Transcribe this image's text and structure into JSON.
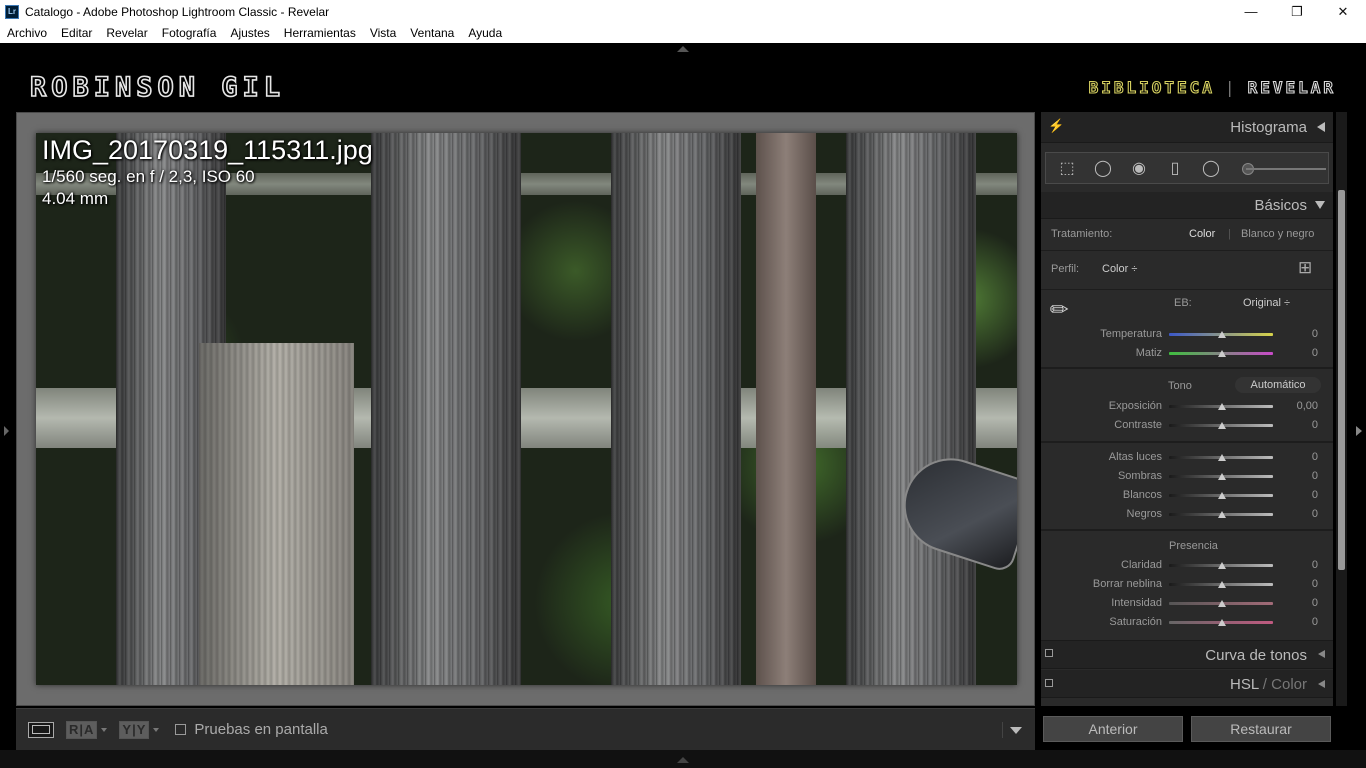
{
  "window": {
    "title": "Catalogo - Adobe Photoshop Lightroom Classic - Revelar",
    "app_icon": "Lr",
    "minimize": "—",
    "maximize": "❐",
    "close": "✕"
  },
  "menu": [
    "Archivo",
    "Editar",
    "Revelar",
    "Fotografía",
    "Ajustes",
    "Herramientas",
    "Vista",
    "Ventana",
    "Ayuda"
  ],
  "identity_plate": "ROBINSON GIL",
  "modules": {
    "active": "BIBLIOTECA",
    "separator": "|",
    "other": "REVELAR"
  },
  "photo_info": {
    "filename": "IMG_20170319_115311.jpg",
    "exposure": "1/560 seg. en f / 2,3, ISO 60",
    "focal": "4.04 mm"
  },
  "toolbar": {
    "before_after_1": "R|A",
    "before_after_2": "Y|Y",
    "soft_proof_label": "Pruebas en pantalla",
    "soft_proof_checked": false
  },
  "panels": {
    "histogram": {
      "title": "Histograma",
      "flash": "⚡"
    },
    "basics": {
      "title": "Básicos",
      "treatment": {
        "label": "Tratamiento:",
        "active": "Color",
        "separator": "|",
        "other": "Blanco y negro"
      },
      "profile": {
        "label": "Perfil:",
        "value": "Color ÷"
      },
      "wb": {
        "label": "EB:",
        "value": "Original ÷"
      },
      "temperature": {
        "label": "Temperatura",
        "value": "0"
      },
      "tint": {
        "label": "Matiz",
        "value": "0"
      },
      "tone": {
        "label": "Tono",
        "auto": "Automático"
      },
      "exposure": {
        "label": "Exposición",
        "value": "0,00"
      },
      "contrast": {
        "label": "Contraste",
        "value": "0"
      },
      "highlights": {
        "label": "Altas luces",
        "value": "0"
      },
      "shadows": {
        "label": "Sombras",
        "value": "0"
      },
      "whites": {
        "label": "Blancos",
        "value": "0"
      },
      "blacks": {
        "label": "Negros",
        "value": "0"
      },
      "presence": {
        "label": "Presencia"
      },
      "clarity": {
        "label": "Claridad",
        "value": "0"
      },
      "dehaze": {
        "label": "Borrar neblina",
        "value": "0"
      },
      "vibrance": {
        "label": "Intensidad",
        "value": "0"
      },
      "saturation": {
        "label": "Saturación",
        "value": "0"
      }
    },
    "tone_curve": {
      "title": "Curva de tonos"
    },
    "hsl": {
      "title_a": "HSL",
      "slash": " / ",
      "title_b": "Color"
    }
  },
  "buttons": {
    "previous": "Anterior",
    "reset": "Restaurar"
  }
}
